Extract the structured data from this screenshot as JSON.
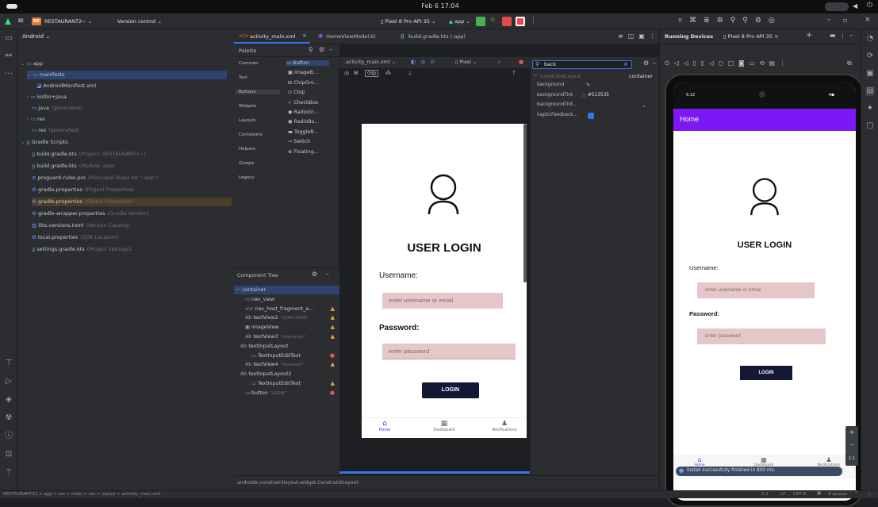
{
  "system": {
    "datetime": "Feb 6  17:04"
  },
  "titlebar": {
    "project_badge": "RE",
    "project_name": "RESTAURANT2~",
    "vcs": "Version control",
    "device": "Pixel 8 Pro API 35",
    "run_config": "app"
  },
  "project": {
    "view_label": "Android",
    "items": [
      {
        "label": "app",
        "hint": ""
      },
      {
        "label": "manifests",
        "hint": ""
      },
      {
        "label": "AndroidManifest.xml",
        "hint": ""
      },
      {
        "label": "kotlin+java",
        "hint": ""
      },
      {
        "label": "java",
        "hint": "(generated)"
      },
      {
        "label": "res",
        "hint": ""
      },
      {
        "label": "res",
        "hint": "(generated)"
      },
      {
        "label": "Gradle Scripts",
        "hint": ""
      },
      {
        "label": "build.gradle.kts",
        "hint": "(Project: RESTAURANT2~)"
      },
      {
        "label": "build.gradle.kts",
        "hint": "(Module :app)"
      },
      {
        "label": "proguard-rules.pro",
        "hint": "(ProGuard Rules for \":app\")"
      },
      {
        "label": "gradle.properties",
        "hint": "(Project Properties)"
      },
      {
        "label": "gradle.properties",
        "hint": "(Global Properties)"
      },
      {
        "label": "gradle-wrapper.properties",
        "hint": "(Gradle Version)"
      },
      {
        "label": "libs.versions.toml",
        "hint": "(Version Catalog)"
      },
      {
        "label": "local.properties",
        "hint": "(SDK Location)"
      },
      {
        "label": "settings.gradle.kts",
        "hint": "(Project Settings)"
      }
    ]
  },
  "editor": {
    "tabs": [
      "activity_main.xml",
      "HomeViewModel.kt",
      "build.gradle.kts (:app)"
    ],
    "file_dropdown": "activity_main.xml",
    "dp_label": "0dp",
    "device_dropdown": "Pixel",
    "search_value": "back",
    "footer_class": "androidx.constraintlayout.widget.ConstraintLayout"
  },
  "palette": {
    "title": "Palette",
    "categories": [
      "Common",
      "Text",
      "Buttons",
      "Widgets",
      "Layouts",
      "Containers",
      "Helpers",
      "Google",
      "Legacy"
    ],
    "items": [
      "Button",
      "ImageB...",
      "ChipGro...",
      "Chip",
      "CheckBox",
      "RadioGr...",
      "RadioBu...",
      "ToggleB...",
      "Switch",
      "Floating..."
    ]
  },
  "component_tree": {
    "title": "Component Tree",
    "rows": [
      {
        "label": "container",
        "hint": ""
      },
      {
        "label": "nav_view",
        "hint": ""
      },
      {
        "label": "nav_host_fragment_a...",
        "hint": ""
      },
      {
        "label": "textView2",
        "hint": "\"USER LOGIN\""
      },
      {
        "label": "imageView",
        "hint": ""
      },
      {
        "label": "textView3",
        "hint": "\"Username:\""
      },
      {
        "label": "textInputLayout",
        "hint": ""
      },
      {
        "label": "TextInputEditText",
        "hint": ""
      },
      {
        "label": "textView4",
        "hint": "\"Password:\""
      },
      {
        "label": "textInputLayout2",
        "hint": ""
      },
      {
        "label": "TextInputEditText",
        "hint": ""
      },
      {
        "label": "button",
        "hint": "\"LOGIN\""
      }
    ]
  },
  "attributes": {
    "header_class": "ConstraintLayout",
    "header_id": "container",
    "rows": [
      {
        "name": "background",
        "value": ""
      },
      {
        "name": "backgroundTint",
        "value": "#513535"
      },
      {
        "name": "backgroundTint...",
        "value": ""
      },
      {
        "name": "hapticFeedback...",
        "value": ""
      }
    ]
  },
  "app_preview": {
    "title": "USER LOGIN",
    "username_label": "Username:",
    "username_placeholder": "enter username or email",
    "password_label": "Password:",
    "password_placeholder": "enter password",
    "login_button": "LOGIN",
    "nav": [
      "Home",
      "Dashboard",
      "Notifications"
    ]
  },
  "running_devices": {
    "title": "Running Devices",
    "device_tab": "Pixel 8 Pro API 35",
    "app_bar_title": "Home",
    "toast": "Install successfully finished in 800 ms."
  },
  "statusbar": {
    "breadcrumb": "RESTAURANT22 > app > src > main > res > layout > activity_main.xml",
    "position": "2:1",
    "line_sep": "LF",
    "encoding": "UTF-8",
    "indent": "4 spaces"
  },
  "colors": {
    "accent": "#7c18f5",
    "field": "#e5c7c9",
    "button": "#131836",
    "ide_bg": "#2b2d30"
  }
}
